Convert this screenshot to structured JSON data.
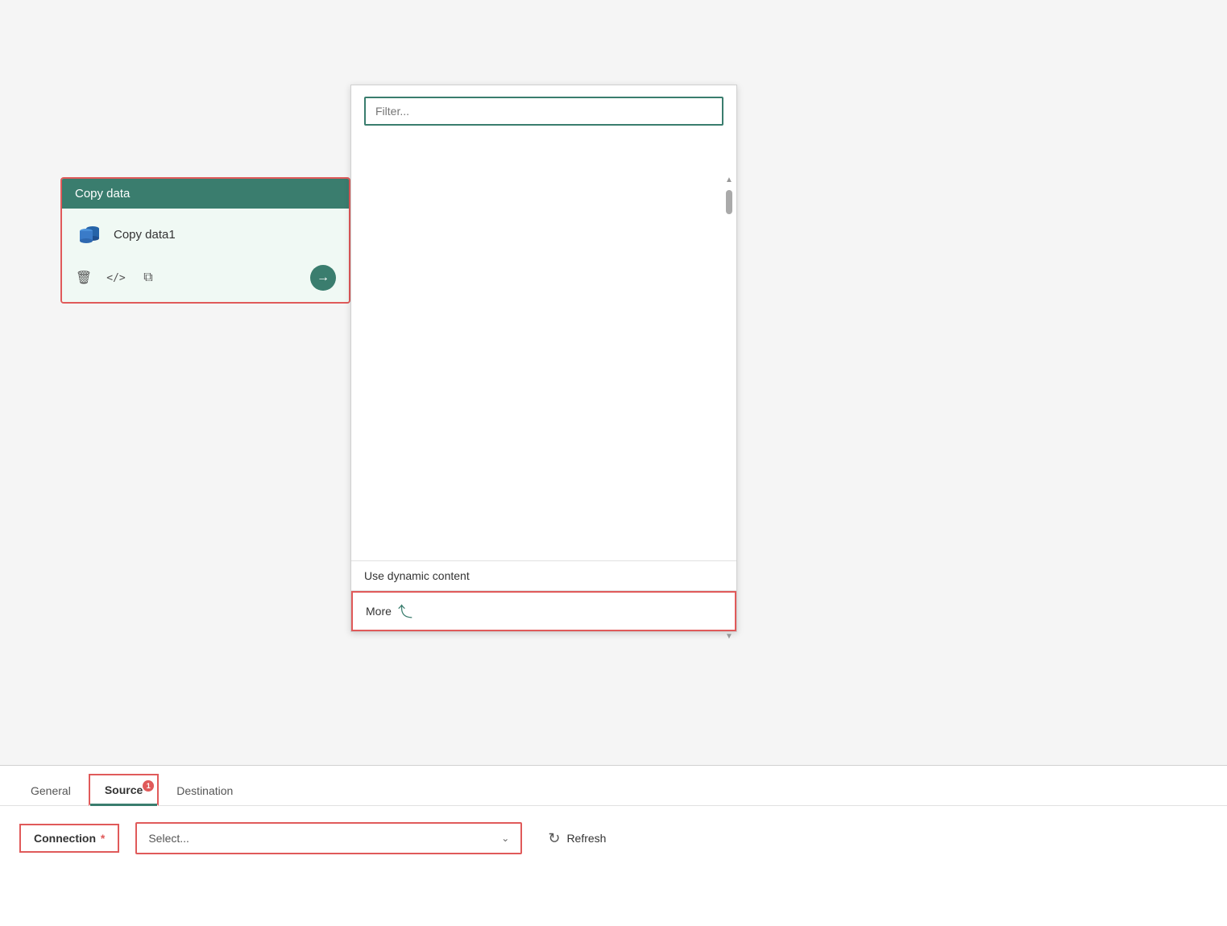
{
  "canvas": {
    "background": "#f0f0f0"
  },
  "copy_data_card": {
    "header": "Copy data",
    "item_name": "Copy data1",
    "border_color": "#e05a5a",
    "header_bg": "#3a7d6e"
  },
  "dropdown_panel": {
    "filter_placeholder": "Filter...",
    "option1": "Use dynamic content",
    "option2": "More",
    "more_arrow": "↵"
  },
  "tabs": [
    {
      "label": "General",
      "active": false,
      "badge": null
    },
    {
      "label": "Source",
      "active": true,
      "badge": "1"
    },
    {
      "label": "Destination",
      "active": false,
      "badge": null
    }
  ],
  "bottom": {
    "connection_label": "Connection",
    "required_star": "*",
    "select_placeholder": "Select...",
    "refresh_label": "Refresh"
  },
  "icons": {
    "delete": "🗑",
    "code": "</>",
    "copy": "⧉",
    "arrow_right": "→",
    "chevron_down": "⌄",
    "refresh": "↻",
    "scroll_up": "▲",
    "scroll_down": "▼"
  }
}
